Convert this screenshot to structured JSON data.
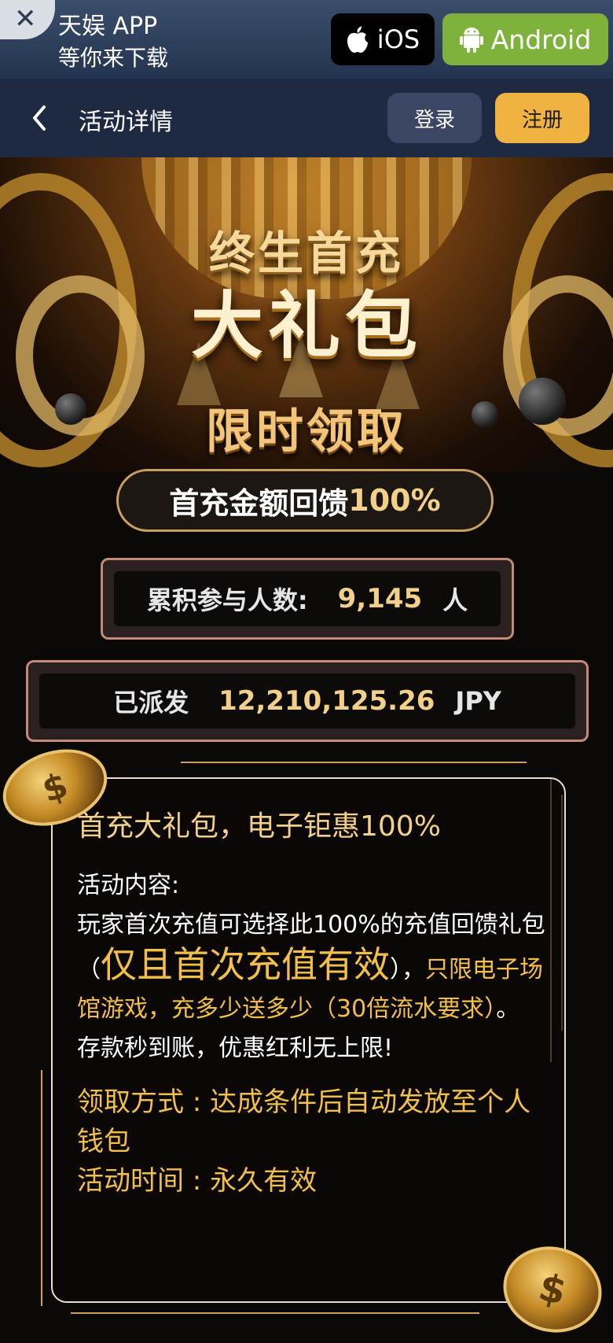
{
  "app_banner": {
    "title": "天娱 APP",
    "subtitle": "等你来下载",
    "ios_label": "iOS",
    "android_label": "Android",
    "close_symbol": "✕"
  },
  "header": {
    "title": "活动详情",
    "login_label": "登录",
    "register_label": "注册"
  },
  "hero": {
    "line1": "终生首充",
    "line2": "大礼包",
    "line3": "限时领取"
  },
  "bonus_pill": {
    "prefix": "首充金额回馈",
    "percent": "100%"
  },
  "stats": {
    "participants": {
      "label": "累积参与人数:",
      "value": "9,145",
      "unit": "人"
    },
    "distributed": {
      "label": "已派发",
      "value": "12,210,125.26",
      "unit": "JPY"
    }
  },
  "content": {
    "title": "首充大礼包，电子钜惠100%",
    "section_label": "活动内容:",
    "body_1": "玩家首次充值可选择此100%的充值回馈礼包（",
    "body_highlight": "仅且首次充值有效",
    "body_2": "），",
    "body_gold": "只限电子场馆游戏，充多少送多少（30倍流水要求）",
    "body_3": "。",
    "body_4": "存款秒到账，优惠红利无上限!",
    "method": "领取方式 : 达成条件后自动发放至个人钱包",
    "time": "活动时间 : 永久有效"
  },
  "colors": {
    "gold": "#f2c04a",
    "android_green": "#7fb23a",
    "register_yellow": "#f0b342",
    "header_bg": "#1d2a42"
  }
}
